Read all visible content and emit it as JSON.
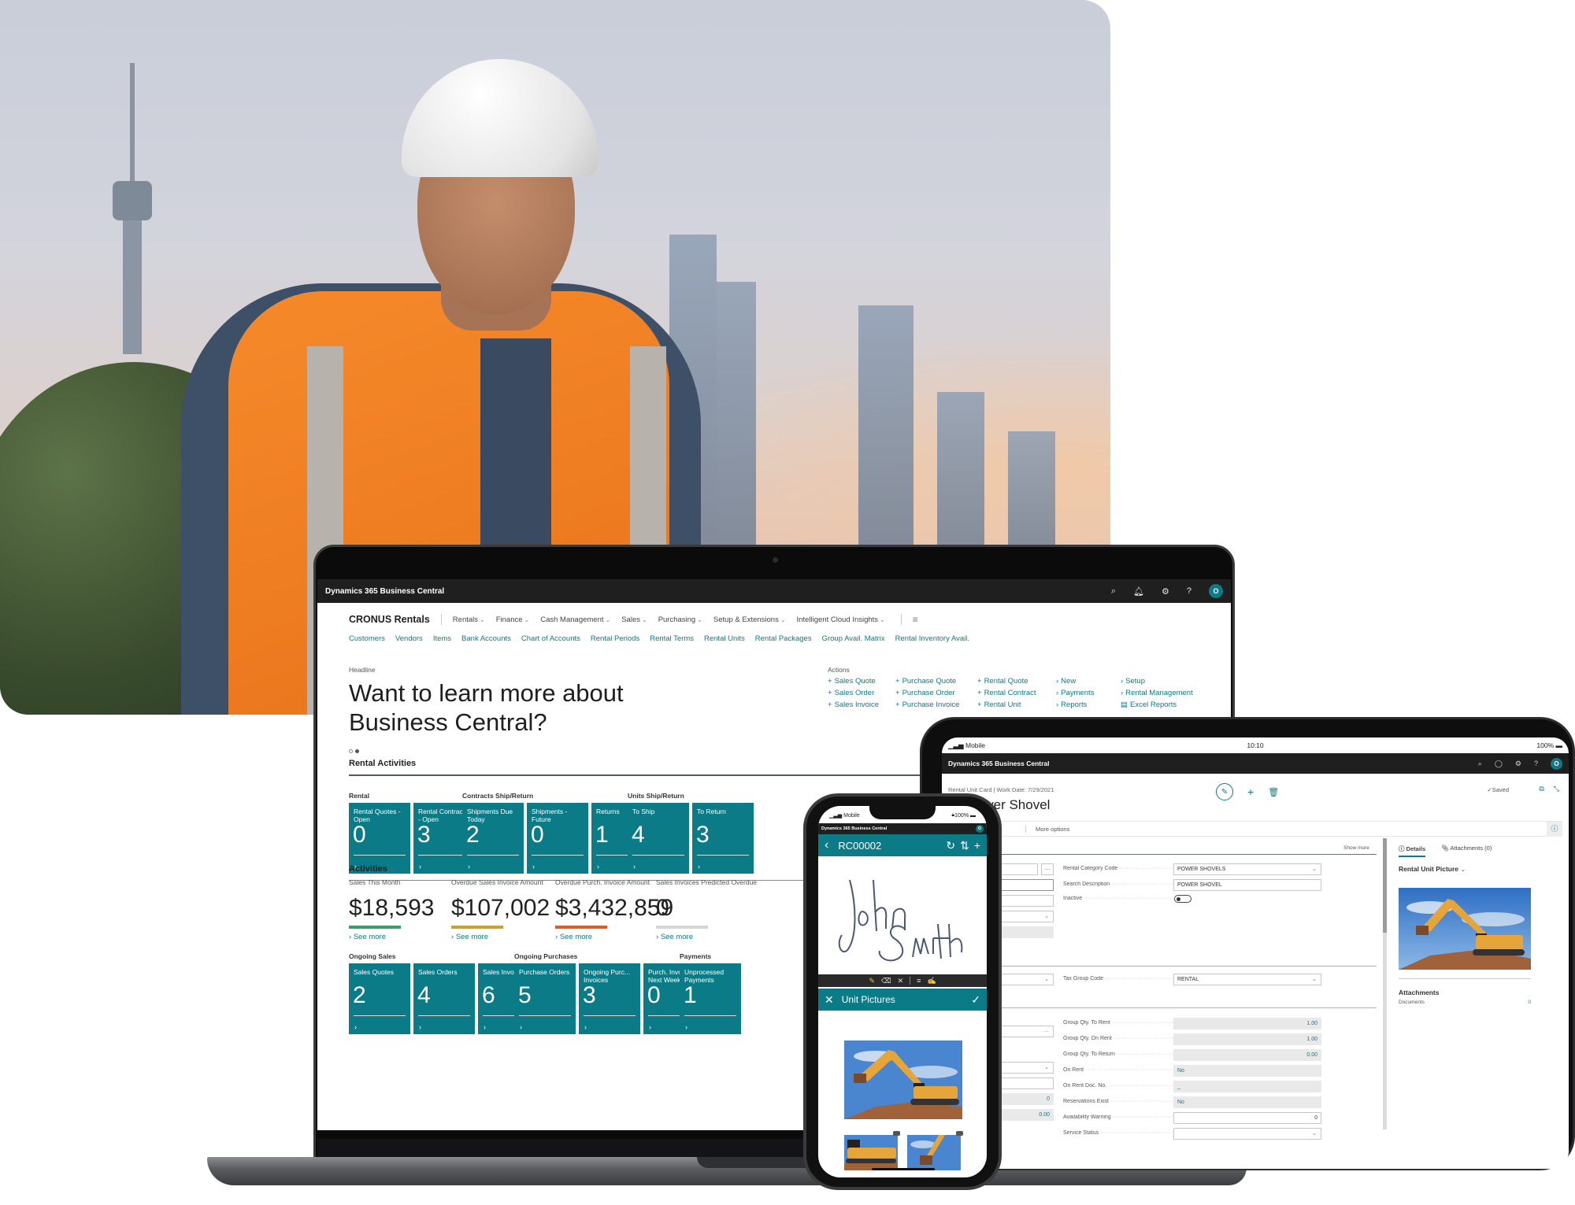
{
  "laptop": {
    "device_label": "Laptop",
    "topbar": {
      "app_title": "Dynamics 365 Business Central",
      "icons": [
        "search-icon",
        "bell-icon",
        "gear-icon",
        "help-icon"
      ],
      "avatar_initial": "O"
    },
    "nav": {
      "company": "CRONUS Rentals",
      "menus": [
        "Rentals",
        "Finance",
        "Cash Management",
        "Sales",
        "Purchasing",
        "Setup & Extensions",
        "Intelligent Cloud Insights"
      ],
      "links": [
        "Customers",
        "Vendors",
        "Items",
        "Bank Accounts",
        "Chart of Accounts",
        "Rental Periods",
        "Rental Terms",
        "Rental Units",
        "Rental Packages",
        "Group Avail. Matrix",
        "Rental Inventory Avail."
      ]
    },
    "headline": {
      "label": "Headline",
      "text": "Want to learn more about Business Central?"
    },
    "actions": {
      "label": "Actions",
      "items": [
        {
          "glyph": "+",
          "label": "Sales Quote"
        },
        {
          "glyph": "+",
          "label": "Purchase Quote"
        },
        {
          "glyph": "+",
          "label": "Rental Quote"
        },
        {
          "glyph": "›",
          "label": "New"
        },
        {
          "glyph": "›",
          "label": "Setup"
        },
        {
          "glyph": "+",
          "label": "Sales Order"
        },
        {
          "glyph": "+",
          "label": "Purchase Order"
        },
        {
          "glyph": "+",
          "label": "Rental Contract"
        },
        {
          "glyph": "›",
          "label": "Payments"
        },
        {
          "glyph": "›",
          "label": "Rental Management"
        },
        {
          "glyph": "+",
          "label": "Sales Invoice"
        },
        {
          "glyph": "+",
          "label": "Purchase Invoice"
        },
        {
          "glyph": "+",
          "label": "Rental Unit"
        },
        {
          "glyph": "›",
          "label": "Reports"
        },
        {
          "glyph": "▤",
          "label": "Excel Reports"
        }
      ]
    },
    "rental_activities": {
      "title": "Rental Activities",
      "groups": [
        {
          "title": "Rental",
          "tiles": [
            {
              "label": "Rental Quotes - Open",
              "value": "0"
            },
            {
              "label": "Rental Contracts - Open",
              "value": "3"
            }
          ]
        },
        {
          "title": "Contracts Ship/Return",
          "tiles": [
            {
              "label": "Shipments Due Today",
              "value": "2"
            },
            {
              "label": "Shipments - Future",
              "value": "0"
            },
            {
              "label": "Returns",
              "value": "1"
            }
          ]
        },
        {
          "title": "Units Ship/Return",
          "tiles": [
            {
              "label": "To Ship",
              "value": "4"
            },
            {
              "label": "To Return",
              "value": "3"
            }
          ]
        }
      ]
    },
    "activities": {
      "title": "Activities",
      "see_more": "See more",
      "kpis": [
        {
          "label": "Sales This Month",
          "value": "$18,593",
          "bar_color": "#3a9e6a"
        },
        {
          "label": "Overdue Sales Invoice Amount",
          "value": "$107,002",
          "bar_color": "#c9a227"
        },
        {
          "label": "Overdue Purch. Invoice Amount",
          "value": "$3,432,859",
          "bar_color": "#e05a2a"
        },
        {
          "label": "Sales Invoices Predicted Overdue",
          "value": "0",
          "bar_color": "#d6d6d6"
        }
      ]
    },
    "ongoing": {
      "groups": [
        {
          "title": "Ongoing Sales",
          "tiles": [
            {
              "label": "Sales Quotes",
              "value": "2"
            },
            {
              "label": "Sales Orders",
              "value": "4"
            },
            {
              "label": "Sales Invoices",
              "value": "6"
            }
          ]
        },
        {
          "title": "Ongoing Purchases",
          "tiles": [
            {
              "label": "Purchase Orders",
              "value": "5"
            },
            {
              "label": "Ongoing Purc... Invoices",
              "value": "3"
            },
            {
              "label": "Purch. Invoices... Next Week",
              "value": "0"
            }
          ]
        },
        {
          "title": "Payments",
          "tiles": [
            {
              "label": "Unprocessed Payments",
              "value": "1"
            }
          ]
        }
      ]
    }
  },
  "tablet": {
    "status": {
      "carrier": "Mobile",
      "time": "10:10",
      "battery": "100%"
    },
    "topbar": {
      "app_title": "Dynamics 365 Business Central",
      "avatar_initial": "O"
    },
    "card": {
      "crumb": "Rental Unit Card | Work Date: 7/29/2021",
      "title": "1 · Power Shovel",
      "saved": "✓Saved",
      "more_options": "More options",
      "show_more": "Show more"
    },
    "fields_general": [
      {
        "label": "Rental Category Code",
        "value": "POWER SHOVELS"
      },
      {
        "label": "Search Description",
        "value": "POWER SHOVEL"
      },
      {
        "label": "Inactive",
        "value": ""
      }
    ],
    "fields_posting": [
      {
        "label": "Tax Group Code",
        "value": "RENTAL"
      }
    ],
    "left_fields_values": [
      "0",
      "0.00"
    ],
    "fields_qty": [
      {
        "label": "Group Qty. To Rent",
        "value": "1.00"
      },
      {
        "label": "Group Qty. On Rent",
        "value": "1.00"
      },
      {
        "label": "Group Qty. To Return",
        "value": "0.00"
      },
      {
        "label": "On Rent",
        "value": "No"
      },
      {
        "label": "On Rent Doc. No.",
        "value": "_"
      },
      {
        "label": "Reservations Exist",
        "value": "No"
      },
      {
        "label": "Availability Warning",
        "value": "0"
      },
      {
        "label": "Service Status",
        "value": ""
      }
    ],
    "factbox": {
      "tabs": [
        "Details",
        "Attachments (0)"
      ],
      "picture_title": "Rental Unit Picture",
      "attachments_title": "Attachments",
      "documents_label": "Documents",
      "documents_count": "0"
    }
  },
  "phone": {
    "status": {
      "carrier": "Mobile",
      "battery": "100%"
    },
    "topbar": {
      "app_title": "Dynamics 365 Business Central",
      "avatar_initial": "O"
    },
    "doc_no": "RC00002",
    "signature": "John Smith",
    "pictures_title": "Unit Pictures"
  }
}
